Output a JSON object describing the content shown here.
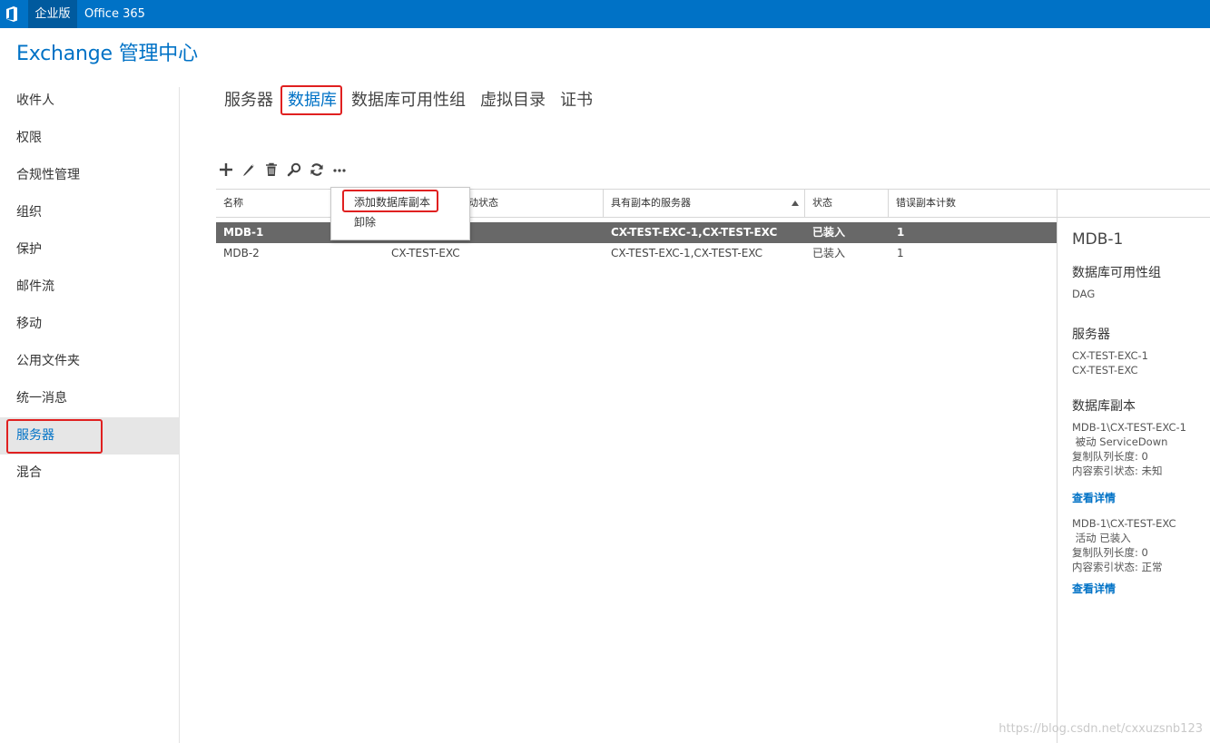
{
  "topbar": {
    "edition": "企业版",
    "suite": "Office 365",
    "icon": "office-logo-icon"
  },
  "app_title": "Exchange 管理中心",
  "nav": {
    "items": [
      {
        "label": "收件人"
      },
      {
        "label": "权限"
      },
      {
        "label": "合规性管理"
      },
      {
        "label": "组织"
      },
      {
        "label": "保护"
      },
      {
        "label": "邮件流"
      },
      {
        "label": "移动"
      },
      {
        "label": "公用文件夹"
      },
      {
        "label": "统一消息"
      },
      {
        "label": "服务器",
        "active": true
      },
      {
        "label": "混合"
      }
    ]
  },
  "tabs": [
    {
      "label": "服务器"
    },
    {
      "label": "数据库",
      "active": true
    },
    {
      "label": "数据库可用性组"
    },
    {
      "label": "虚拟目录"
    },
    {
      "label": "证书"
    }
  ],
  "toolbar": {
    "buttons": [
      "add-icon",
      "edit-icon",
      "delete-icon",
      "search-icon",
      "refresh-icon",
      "more-icon"
    ]
  },
  "context_menu": {
    "items": [
      {
        "label": "添加数据库副本"
      },
      {
        "label": "卸除"
      }
    ]
  },
  "table": {
    "columns": [
      "名称",
      "动状态",
      "具有副本的服务器",
      "状态",
      "错误副本计数"
    ],
    "sorted_column": "具有副本的服务器",
    "rows": [
      {
        "name": "MDB-1",
        "active_server": "",
        "servers": "CX-TEST-EXC-1,CX-TEST-EXC",
        "status": "已装入",
        "bad_copies": "1",
        "selected": true
      },
      {
        "name": "MDB-2",
        "active_server": "CX-TEST-EXC",
        "servers": "CX-TEST-EXC-1,CX-TEST-EXC",
        "status": "已装入",
        "bad_copies": "1",
        "selected": false
      }
    ]
  },
  "details": {
    "title": "MDB-1",
    "dag_heading": "数据库可用性组",
    "dag_value": "DAG",
    "servers_heading": "服务器",
    "servers": [
      "CX-TEST-EXC-1",
      "CX-TEST-EXC"
    ],
    "copies_heading": "数据库副本",
    "copies": [
      {
        "name": "MDB-1\\CX-TEST-EXC-1",
        "state": " 被动 ServiceDown",
        "queue": "复制队列长度: 0",
        "index": "内容索引状态: 未知",
        "link": "查看详情"
      },
      {
        "name": "MDB-1\\CX-TEST-EXC",
        "state": " 活动 已装入",
        "queue": "复制队列长度: 0",
        "index": "内容索引状态: 正常",
        "link": "查看详情"
      }
    ]
  },
  "watermark": "https://blog.csdn.net/cxxuzsnb123",
  "colors": {
    "accent": "#0072c6",
    "highlight": "#e02020",
    "selected_row": "#686868"
  }
}
